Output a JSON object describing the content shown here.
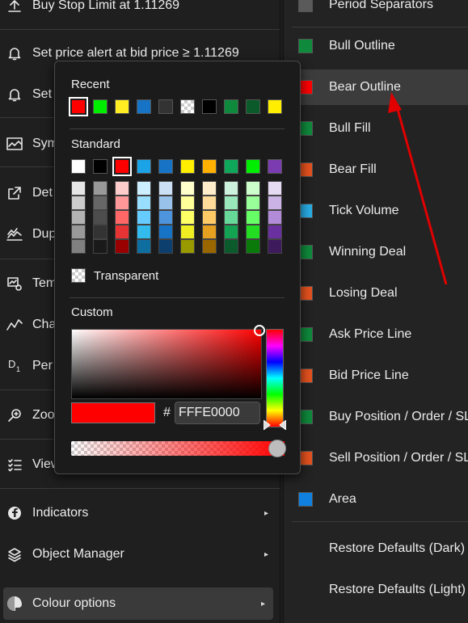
{
  "left_menu": {
    "items": [
      {
        "label": "Buy Stop Limit at 1.11269",
        "icon": "upload-icon"
      },
      {
        "label": "Set price alert at bid price ≥ 1.11269",
        "icon": "bell-icon"
      },
      {
        "label": "Set",
        "icon": "bell-icon"
      },
      {
        "label": "Sym",
        "icon": "chart-line-icon"
      },
      {
        "label": "Det",
        "icon": "external-link-icon"
      },
      {
        "label": "Dup",
        "icon": "duplicate-chart-icon"
      },
      {
        "label": "Tem",
        "icon": "template-icon"
      },
      {
        "label": "Cha",
        "icon": "chart-type-icon"
      },
      {
        "label": "Per",
        "icon": "period-icon",
        "icon_text": "D",
        "icon_sub": "1"
      },
      {
        "label": "Zoo",
        "icon": "zoom-icon"
      },
      {
        "label": "View",
        "icon": "list-check-icon"
      },
      {
        "label": "Indicators",
        "icon": "indicator-icon"
      },
      {
        "label": "Object Manager",
        "icon": "layers-icon"
      },
      {
        "label": "Colour options",
        "icon": "palette-icon"
      }
    ],
    "arrow_glyph": "▸"
  },
  "right_menu": {
    "items": [
      {
        "label": "Period Separators",
        "color": "#5a5a5a"
      },
      {
        "label": "Bull Outline",
        "color": "#0f8a3c"
      },
      {
        "label": "Bear Outline",
        "color": "#ff0000"
      },
      {
        "label": "Bull Fill",
        "color": "#0f8a3c"
      },
      {
        "label": "Bear Fill",
        "color": "#e6521f"
      },
      {
        "label": "Tick Volume",
        "color": "#29aee6"
      },
      {
        "label": "Winning Deal",
        "color": "#0f8a3c"
      },
      {
        "label": "Losing Deal",
        "color": "#e6521f"
      },
      {
        "label": "Ask Price Line",
        "color": "#0f8a3c"
      },
      {
        "label": "Bid Price Line",
        "color": "#e6521f"
      },
      {
        "label": "Buy Position / Order / SL",
        "color": "#0f8a3c"
      },
      {
        "label": "Sell Position / Order / SL",
        "color": "#e6521f"
      },
      {
        "label": "Area",
        "color": "#1080e0"
      },
      {
        "label": "Restore Defaults (Dark)",
        "color": ""
      },
      {
        "label": "Restore Defaults (Light)",
        "color": ""
      }
    ],
    "highlighted_item": "Bear Outline"
  },
  "picker": {
    "recent_label": "Recent",
    "recent": [
      "#ff0000",
      "#00ee00",
      "#ffee22",
      "#1673c6",
      "#333333",
      "checker",
      "#000000",
      "#0f8a3c",
      "#0a5a2a",
      "#ffee00"
    ],
    "standard_label": "Standard",
    "standard": [
      "#ffffff",
      "#000000",
      "#ff0000",
      "#1aa3e6",
      "#1673c6",
      "#ffee00",
      "#ffb000",
      "#0fa85a",
      "#00ee00",
      "#7a3cb0"
    ],
    "shades": [
      [
        "#e6e6e6",
        "#cccccc",
        "#b3b3b3",
        "#999999",
        "#808080"
      ],
      [
        "#999999",
        "#666666",
        "#4d4d4d",
        "#333333",
        "#1a1a1a"
      ],
      [
        "#ffcccc",
        "#ff9999",
        "#ff6666",
        "#e63333",
        "#990000"
      ],
      [
        "#cceeff",
        "#99ddff",
        "#66ccff",
        "#33bbee",
        "#0e6ea0"
      ],
      [
        "#cce0f5",
        "#99c2eb",
        "#4d94dd",
        "#1673c6",
        "#0c3f6e"
      ],
      [
        "#ffffcc",
        "#ffff99",
        "#ffff66",
        "#eeee22",
        "#999900"
      ],
      [
        "#ffedcc",
        "#ffdb99",
        "#ffc966",
        "#e6a020",
        "#996600"
      ],
      [
        "#ccf2dd",
        "#99e6bb",
        "#66d999",
        "#13a352",
        "#0a5a2c"
      ],
      [
        "#ccffcc",
        "#99ff99",
        "#66ff66",
        "#22dd22",
        "#0a7a0a"
      ],
      [
        "#e6d9f2",
        "#ccb3e6",
        "#b38cd9",
        "#6a30a0",
        "#3d1a5c"
      ]
    ],
    "transparent_label": "Transparent",
    "custom_label": "Custom",
    "hash": "#",
    "hex_value": "FFFE0000",
    "current_color": "#ff0000"
  }
}
